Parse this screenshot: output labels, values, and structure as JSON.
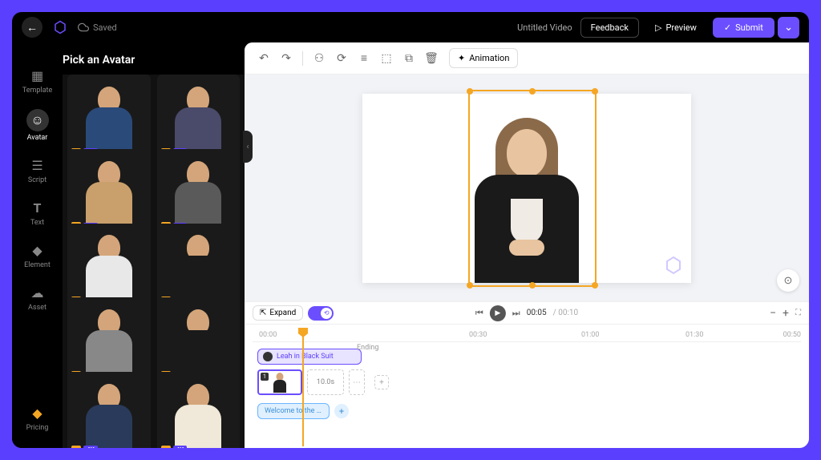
{
  "topbar": {
    "saved_label": "Saved",
    "title": "Untitled Video",
    "feedback": "Feedback",
    "preview": "Preview",
    "submit": "Submit"
  },
  "sidebar": {
    "items": [
      {
        "label": "Template"
      },
      {
        "label": "Avatar"
      },
      {
        "label": "Script"
      },
      {
        "label": "Text"
      },
      {
        "label": "Element"
      },
      {
        "label": "Asset"
      }
    ],
    "pricing": "Pricing"
  },
  "panel": {
    "title": "Pick an Avatar",
    "badge_4k": "4K",
    "avatars": [
      {
        "color": "#2a4a7a"
      },
      {
        "color": "#4a4a6a"
      },
      {
        "color": "#c9a06b"
      },
      {
        "color": "#5a5a5a"
      },
      {
        "color": "#e8e8e8"
      },
      {
        "color": "#1a1a1a"
      },
      {
        "color": "#888"
      },
      {
        "color": "#1a1a1a"
      },
      {
        "color": "#2a3a5a"
      },
      {
        "color": "#f0e8d8"
      }
    ]
  },
  "toolbar": {
    "animation": "Animation"
  },
  "player": {
    "expand": "Expand",
    "current": "00:05",
    "total": "00:10"
  },
  "timeline": {
    "marks": [
      "00:00",
      "00:30",
      "01:00",
      "01:30"
    ],
    "end_mark": "00:50",
    "ending": "Ending",
    "clip_name": "Leah in Black Suit",
    "scene_number": "1",
    "duration": "10.0s",
    "script_text": "Welcome to the new ..."
  }
}
